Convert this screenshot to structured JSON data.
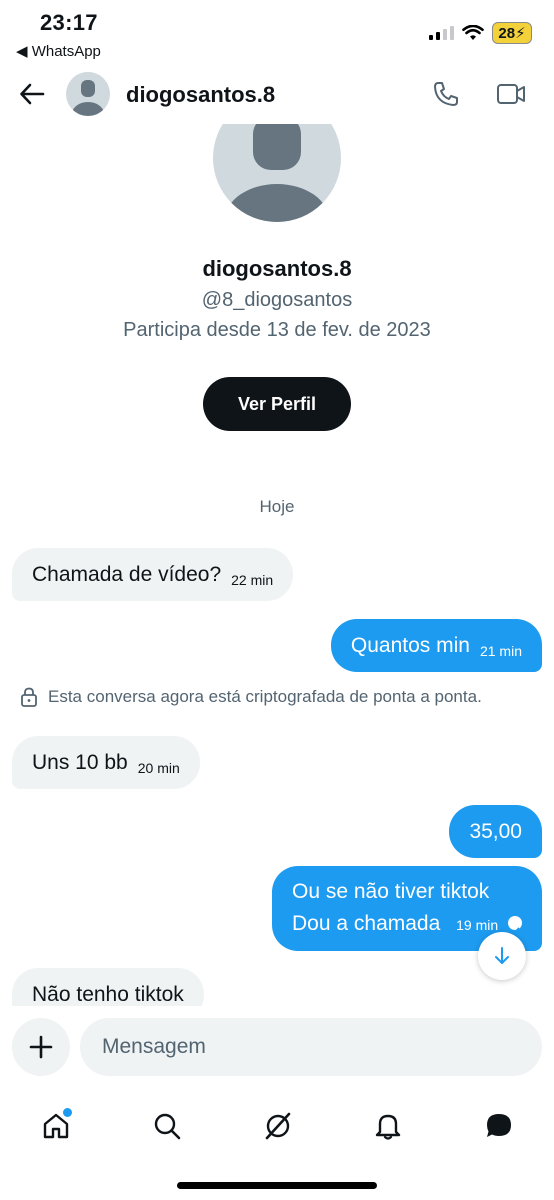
{
  "status_bar": {
    "time": "23:17",
    "back_app": "◀ WhatsApp",
    "battery": "28⚡",
    "icons": [
      "signal-icon",
      "wifi-icon",
      "battery-icon"
    ]
  },
  "header": {
    "username": "diogosantos.8",
    "icons": [
      "back-arrow-icon",
      "phone-icon",
      "video-camera-icon"
    ]
  },
  "profile": {
    "name": "diogosantos.8",
    "handle": "@8_diogosantos",
    "joined": "Participa desde 13 de fev. de 2023",
    "view_button": "Ver Perfil"
  },
  "conversation": {
    "day_label": "Hoje",
    "notice": "Esta conversa agora está criptografada de ponta a ponta.",
    "messages": [
      {
        "direction": "in",
        "text": "Chamada de vídeo?",
        "time": "22 min"
      },
      {
        "direction": "out",
        "text": "Quantos min",
        "time": "21 min"
      },
      {
        "direction": "in",
        "text": "Uns 10 bb",
        "time": "20 min"
      },
      {
        "direction": "out",
        "text": "35,00",
        "time": ""
      },
      {
        "direction": "out",
        "lines": [
          "Ou se não tiver tiktok",
          "Dou a chamada"
        ],
        "time": "19 min"
      },
      {
        "direction": "in",
        "text": "Não tenho tiktok",
        "time": ""
      }
    ]
  },
  "composer": {
    "placeholder": "Mensagem"
  },
  "nav": {
    "items": [
      "home-icon",
      "search-icon",
      "grok-icon",
      "notifications-icon",
      "messages-icon"
    ]
  },
  "colors": {
    "accent": "#1d9bf0",
    "bubble_in": "#eff3f4",
    "text_primary": "#0f1419",
    "text_secondary": "#536471",
    "battery": "#f2d13b"
  }
}
